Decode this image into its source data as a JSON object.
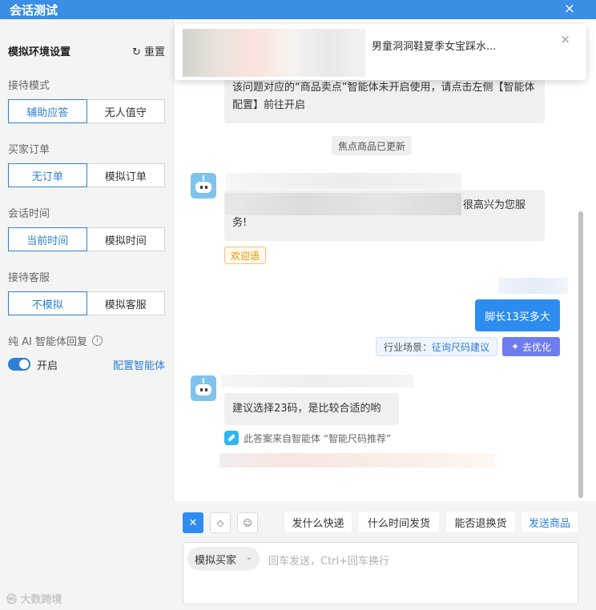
{
  "window": {
    "title": "会话测试",
    "close_glyph": "×"
  },
  "sidebar": {
    "title": "模拟环境设置",
    "reset_label": "重置",
    "reception_mode": {
      "label": "接待模式",
      "options": [
        "辅助应答",
        "无人值守"
      ],
      "selected": 0
    },
    "buyer_order": {
      "label": "买家订单",
      "options": [
        "无订单",
        "模拟订单"
      ],
      "selected": 0
    },
    "session_time": {
      "label": "会话时间",
      "options": [
        "当前时间",
        "模拟时间"
      ],
      "selected": 0
    },
    "agent": {
      "label": "接待客服",
      "options": [
        "不模拟",
        "模拟客服"
      ],
      "selected": 0
    },
    "pure_ai": {
      "label": "纯 AI 智能体回复",
      "toggle_on": true,
      "toggle_label": "开启",
      "config_link": "配置智能体"
    },
    "watermark": "大数跨境"
  },
  "toast": {
    "text": "男童洞洞鞋夏季女宝踩水...",
    "close_glyph": "×"
  },
  "chat": {
    "notice": "该问题对应的“商品卖点”智能体未开启使用，请点击左侧【智能体配置】前往开启",
    "system_pill": "焦点商品已更新",
    "bot_welcome": {
      "tail": "很高兴为您服",
      "line2": "务!",
      "tag": "欢迎语"
    },
    "user_msg": "脚长13买多大",
    "scene_label": "行业场景：",
    "scene_value": "征询尺码建议",
    "optimize_label": "去优化",
    "bot_reply": "建议选择23码，是比较合适的哟",
    "source_line": "此答案来自智能体 “智能尺码推荐”"
  },
  "composer": {
    "quick_replies": [
      "发什么快递",
      "什么时间发货",
      "能否退换货",
      "发送商品"
    ],
    "buyer_select": "模拟买家",
    "placeholder": "回车发送，Ctrl+回车换行"
  },
  "colors": {
    "accent": "#2d7fd3",
    "title_bar": "#3a8ee6",
    "user_bubble": "#2d8cf0",
    "optimize": "#6f7cf0"
  }
}
